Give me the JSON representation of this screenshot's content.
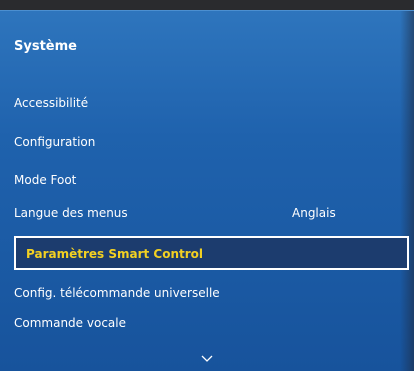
{
  "menu": {
    "title": "Système",
    "items": [
      {
        "label": "Accessibilité",
        "value": ""
      },
      {
        "label": "Configuration",
        "value": ""
      },
      {
        "label": "Mode Foot",
        "value": ""
      },
      {
        "label": "Langue des menus",
        "value": "Anglais"
      },
      {
        "label": "Paramètres Smart Control",
        "value": ""
      },
      {
        "label": "Config. télécommande universelle",
        "value": ""
      },
      {
        "label": "Commande vocale",
        "value": ""
      }
    ],
    "scroll_icon": "chevron-down-icon"
  },
  "colors": {
    "panel": "#1f62ad",
    "highlight_text": "#f2d022",
    "highlight_bg": "#1c3c6e"
  }
}
